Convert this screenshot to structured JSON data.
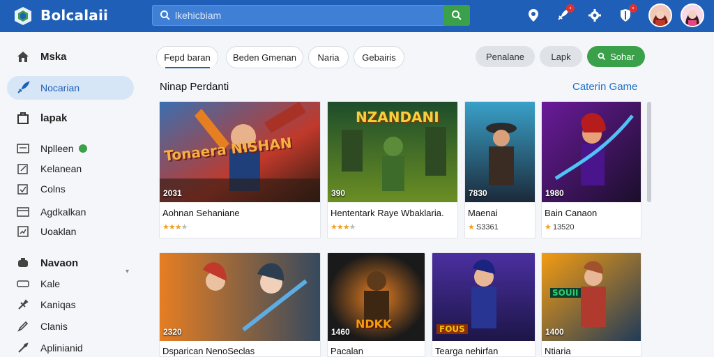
{
  "header": {
    "brand": "Bolcalaii",
    "search_placeholder": "lkehicbiam"
  },
  "sidebar": {
    "items": [
      {
        "label": "Mska",
        "icon": "home-icon"
      },
      {
        "label": "Nocarian",
        "icon": "rocket-icon",
        "active": true
      },
      {
        "label": "lapak",
        "icon": "bag-icon"
      },
      {
        "label": "Nplleen",
        "icon": "tablet-icon",
        "dot": true
      },
      {
        "label": "Kelanean",
        "icon": "edit-icon"
      },
      {
        "label": "Colns",
        "icon": "checklist-icon"
      },
      {
        "label": "Agdkalkan",
        "icon": "card-icon"
      },
      {
        "label": "Uoaklan",
        "icon": "chart-icon"
      },
      {
        "label": "Navaon",
        "icon": "controller-icon"
      },
      {
        "label": "Kale",
        "icon": "rectangle-icon"
      },
      {
        "label": "Kaniqas",
        "icon": "puzzle-icon"
      },
      {
        "label": "Clanis",
        "icon": "pen-icon"
      },
      {
        "label": "Aplinianid",
        "icon": "wrench-icon"
      }
    ]
  },
  "tabs": [
    "Fepd baran",
    "Beden Gmenan",
    "Naria",
    "Gebairis"
  ],
  "actions": [
    "Penalane",
    "Lapk",
    "Sohar"
  ],
  "section": {
    "title": "Ninap Perdanti",
    "link": "Caterin Game"
  },
  "cards": [
    {
      "count": "2031",
      "title": "Aohnan Sehaniane",
      "stars": 3,
      "rating": "",
      "art_text": "Tonaera NISHAN"
    },
    {
      "count": "390",
      "title": "Hententark Raye Wbaklaria.",
      "stars": 3,
      "rating": "",
      "art_text": "NZANDANI"
    },
    {
      "count": "7830",
      "title": "Maenai",
      "stars": 1,
      "rating": "S3361",
      "art_text": ""
    },
    {
      "count": "1980",
      "title": "Bain Canaon",
      "stars": 1,
      "rating": "13520",
      "art_text": ""
    },
    {
      "count": "2320",
      "title": "Dsparican NenoSeclas",
      "stars": 0,
      "rating": "",
      "art_text": ""
    },
    {
      "count": "1460",
      "title": "Pacalan",
      "stars": 0,
      "rating": "",
      "art_text": "NDKK"
    },
    {
      "count": "",
      "title": "Tearga nehirfan",
      "stars": 0,
      "rating": "",
      "art_text": "FOUS"
    },
    {
      "count": "1400",
      "title": "Ntiaria",
      "stars": 0,
      "rating": "",
      "art_text": "SOUII"
    }
  ],
  "colors": {
    "header": "#1f5fb8",
    "accent_green": "#3aa04a",
    "link": "#1f6fc8"
  }
}
